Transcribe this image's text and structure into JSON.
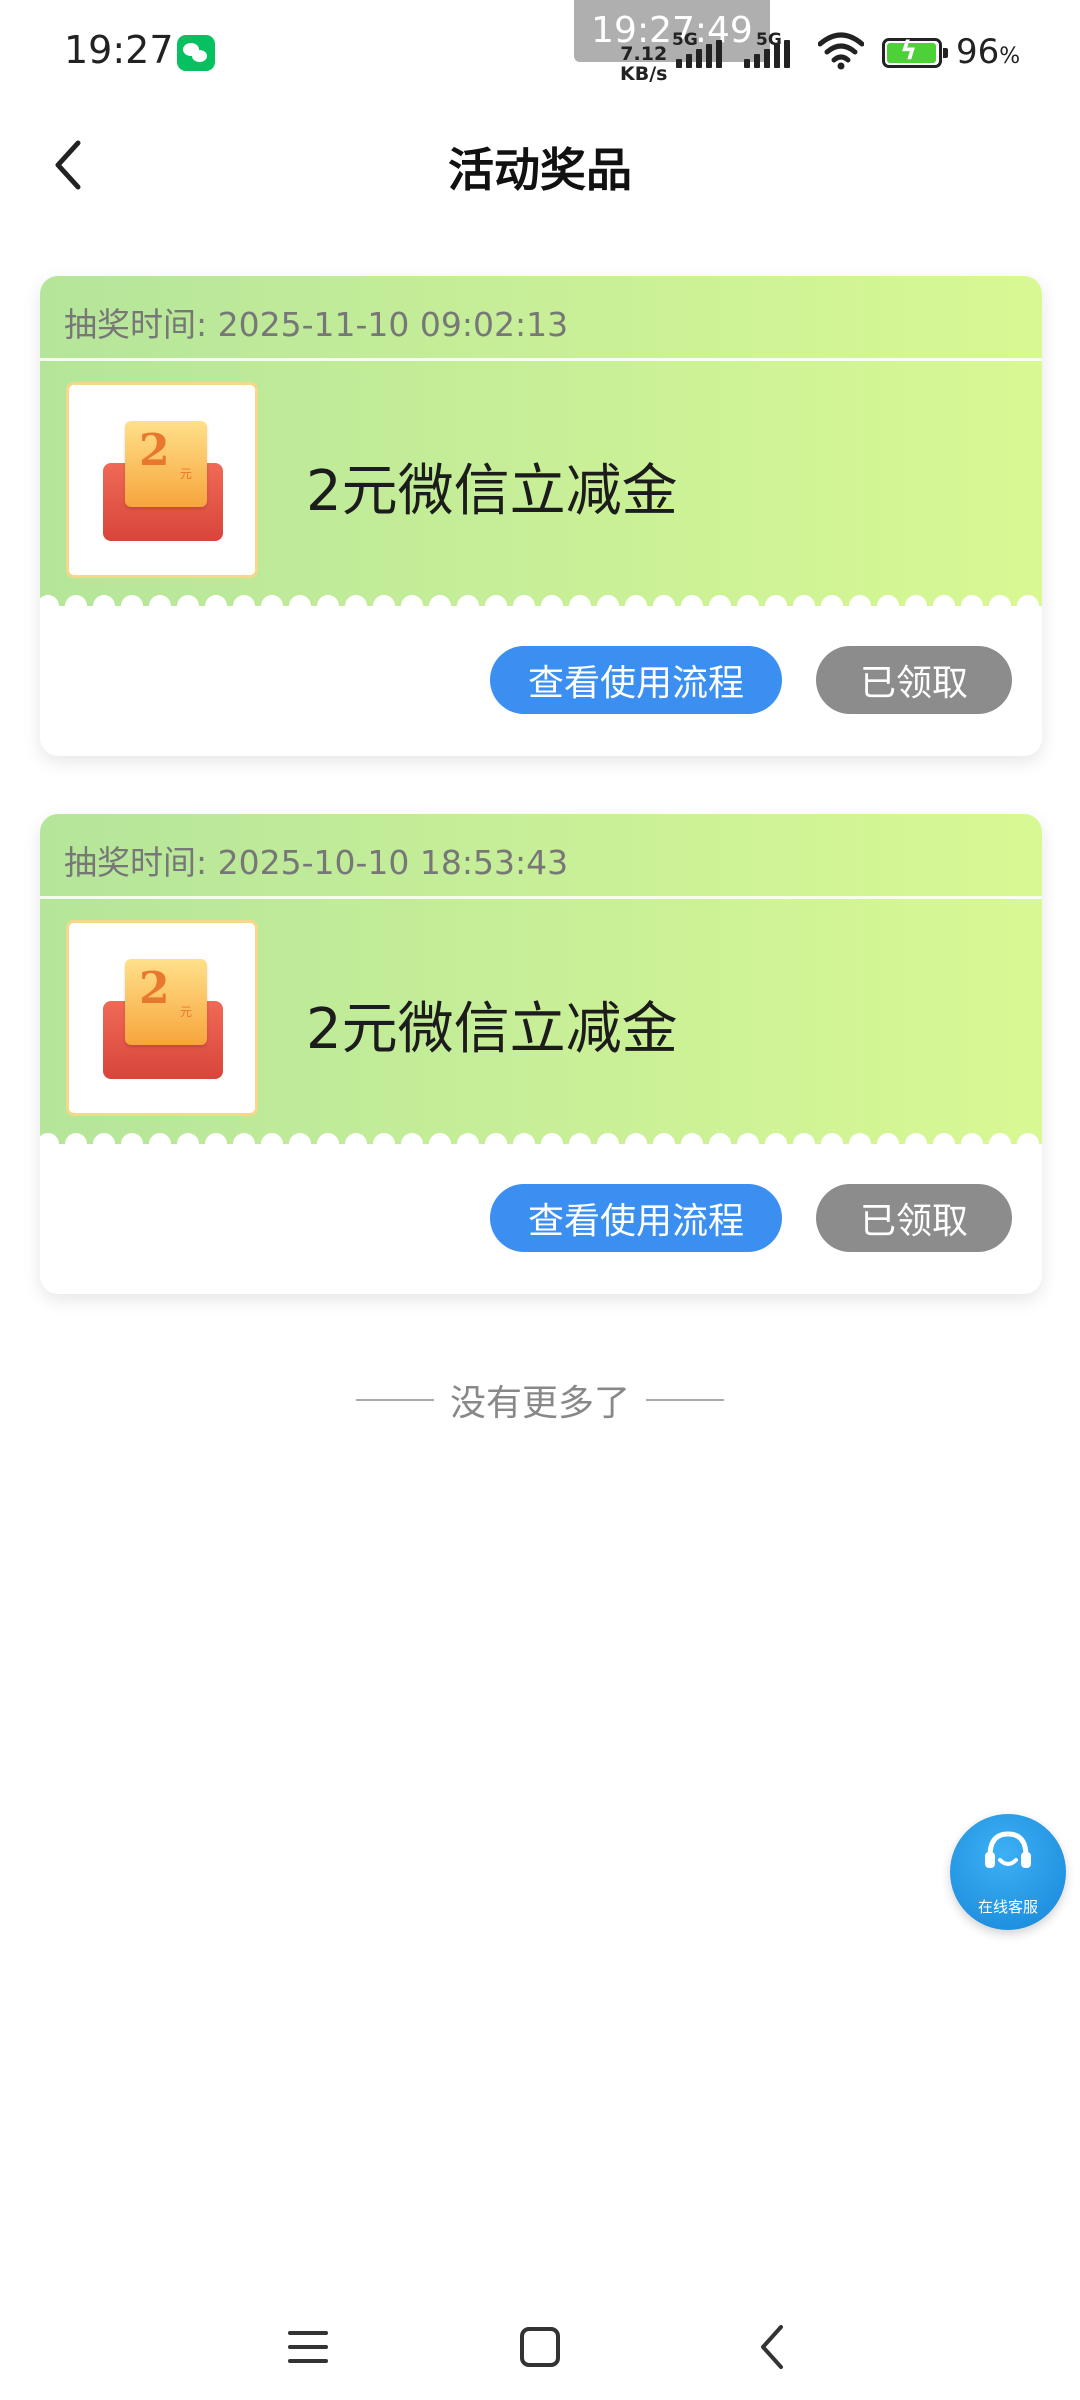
{
  "status_bar": {
    "time": "19:27",
    "overlay_time": "19:27:49",
    "net_speed_value": "7.12",
    "net_speed_unit": "KB/s",
    "sim1_type": "5G",
    "sim2_type": "5G",
    "battery_percent": "96",
    "battery_unit": "%",
    "icons": [
      "wechat-icon",
      "signal-icon",
      "wifi-icon",
      "battery-charging-icon"
    ]
  },
  "header": {
    "title": "活动奖品",
    "back_icon": "chevron-left-icon"
  },
  "prizes": [
    {
      "time_label": "抽奖时间:",
      "time_value": "2025-11-10 09:02:13",
      "thumb_amount": "2",
      "thumb_unit": "元",
      "name": "2元微信立减金",
      "process_label": "查看使用流程",
      "status_label": "已领取"
    },
    {
      "time_label": "抽奖时间:",
      "time_value": "2025-10-10 18:53:43",
      "thumb_amount": "2",
      "thumb_unit": "元",
      "name": "2元微信立减金",
      "process_label": "查看使用流程",
      "status_label": "已领取"
    }
  ],
  "list_end": {
    "text": "没有更多了"
  },
  "support": {
    "label": "在线客服",
    "icon": "headset-icon"
  },
  "nav_bar": {
    "icons": [
      "menu-icon",
      "home-icon",
      "back-icon"
    ]
  },
  "colors": {
    "card_gradient_start": "#b5e59a",
    "card_gradient_end": "#d8f893",
    "process_button": "#3a8ff0",
    "claimed_button": "#8c8c8c",
    "support_bubble": "#1686d8"
  }
}
